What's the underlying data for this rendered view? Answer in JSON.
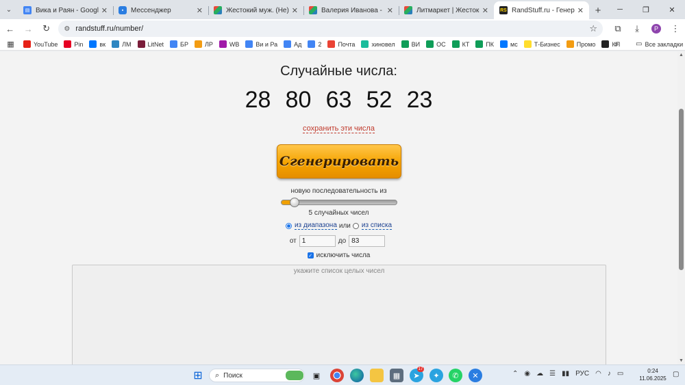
{
  "tabs": [
    {
      "title": "Вика и Раян - Google Документы",
      "favicon": "docs-icon",
      "active": false
    },
    {
      "title": "Мессенджер",
      "favicon": "messenger-icon",
      "active": false
    },
    {
      "title": "Жестокий муж. (Не)любимая",
      "favicon": "litmarket-icon",
      "active": false
    },
    {
      "title": "Валерия Иванова - читать",
      "favicon": "litmarket-icon",
      "active": false
    },
    {
      "title": "Литмаркет | Жестокий муж",
      "favicon": "litmarket-icon",
      "active": false
    },
    {
      "title": "RandStuff.ru - Генератор случайных чисел",
      "favicon": "randstuff-icon",
      "active": true
    }
  ],
  "address_bar": {
    "url": "randstuff.ru/number/"
  },
  "profile_initial": "P",
  "bookmarks": [
    {
      "label": "YouTube",
      "color": "#e62117"
    },
    {
      "label": "Pin",
      "color": "#e60023"
    },
    {
      "label": "вк",
      "color": "#0077ff"
    },
    {
      "label": "ЛМ",
      "color": "#2e86c1"
    },
    {
      "label": "LitNet",
      "color": "#7b1e3a"
    },
    {
      "label": "БР",
      "color": "#4285f4"
    },
    {
      "label": "ЛР",
      "color": "#f39c12"
    },
    {
      "label": "WB",
      "color": "#a01aa8"
    },
    {
      "label": "Ви и Ра",
      "color": "#4285f4"
    },
    {
      "label": "Ад",
      "color": "#4285f4"
    },
    {
      "label": "2",
      "color": "#4285f4"
    },
    {
      "label": "Почта",
      "color": "#ea4335"
    },
    {
      "label": "хиновел",
      "color": "#1abc9c"
    },
    {
      "label": "ВИ",
      "color": "#0f9d58"
    },
    {
      "label": "ОС",
      "color": "#0f9d58"
    },
    {
      "label": "КТ",
      "color": "#0f9d58"
    },
    {
      "label": "ПК",
      "color": "#0f9d58"
    },
    {
      "label": "мс",
      "color": "#0077ff"
    },
    {
      "label": "Т-Бизнес",
      "color": "#ffdd2d"
    },
    {
      "label": "Промо",
      "color": "#f39c12"
    },
    {
      "label": "КП",
      "color": "#222222"
    }
  ],
  "bookmarks_all": "Все закладки",
  "page": {
    "title": "Случайные числа:",
    "numbers": [
      "28",
      "80",
      "63",
      "52",
      "23"
    ],
    "save_link": "сохранить эти числа",
    "generate_button": "Сгенерировать",
    "sequence_label": "новую последовательность из",
    "slider_value_fraction": 0.08,
    "count_label": "5 случайных чисел",
    "source_range": "из диапазона",
    "source_or": "или",
    "source_list": "из списка",
    "source_selected": "range",
    "from_label": "от",
    "from_value": "1",
    "to_label": "до",
    "to_value": "83",
    "exclude_label": "исключить числа",
    "exclude_checked": true,
    "exclude_placeholder": "укажите список целых чисел"
  },
  "taskbar": {
    "search_label": "Поиск",
    "language": "РУС",
    "time": "0:24",
    "date": "11.06.2025",
    "telegram_badge": "17"
  },
  "colors": {
    "accent": "#1a73e8",
    "button_orange": "#f5a300",
    "link_red": "#c0392b"
  }
}
